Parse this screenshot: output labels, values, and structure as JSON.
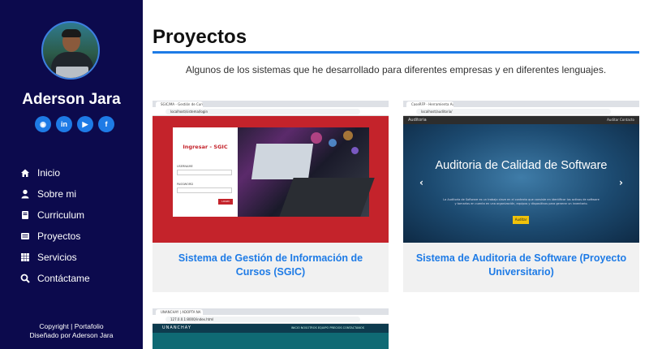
{
  "profile": {
    "name": "Aderson Jara"
  },
  "socials": [
    {
      "icon": "github-icon",
      "glyph": "◉"
    },
    {
      "icon": "linkedin-icon",
      "glyph": "in"
    },
    {
      "icon": "youtube-icon",
      "glyph": "▶"
    },
    {
      "icon": "facebook-icon",
      "glyph": "f"
    }
  ],
  "nav": [
    {
      "label": "Inicio",
      "icon": "home-icon"
    },
    {
      "label": "Sobre mi",
      "icon": "user-icon"
    },
    {
      "label": "Curriculum",
      "icon": "book-icon"
    },
    {
      "label": "Proyectos",
      "icon": "list-icon"
    },
    {
      "label": "Servicios",
      "icon": "grid-icon"
    },
    {
      "label": "Contáctame",
      "icon": "search-icon"
    }
  ],
  "footer": {
    "line1": "Copyright | Portafolio",
    "line2": "Diseñado por Aderson Jara"
  },
  "main": {
    "title": "Proyectos",
    "subtitle": "Algunos de los sistemas que he desarrollado para diferentes empresas y en diferentes lenguajes."
  },
  "projects": [
    {
      "title": "Sistema de Gestión de Información de Cursos (SGIC)",
      "shot": {
        "tab": "SGIC/MA - Gestión de Cursos",
        "url": "localhost/sistema/login",
        "form_title": "Ingresar - SGIC",
        "user_label": "USERNAME",
        "pass_label": "PASSWORD",
        "button": "LOGIN"
      }
    },
    {
      "title": "Sistema de Auditoria de Software (Proyecto Universitario)",
      "shot": {
        "tab": "CaseRFP - Herramienta Auditoria",
        "url": "localhost/auditoria/",
        "brand": "Auditoria",
        "links": "Auditar    Contacto",
        "hero_title": "Auditoria de Calidad de Software",
        "hero_text": "La Auditoría de Software es un trabajo clave en el contexto que consiste en identificar los activos de software y tomarlos en cuenta en una organización, equipos y dispositivos para generar un inventario.",
        "button": "Auditar"
      }
    },
    {
      "title": "",
      "shot": {
        "tab": "UNANCHAY | ADOPTA NA",
        "url": "127.0.0.1:8000/index.html",
        "brand": "UNANCHAY",
        "links": "INICIO   NOSOTROS   EQUIPO   PRECIOS   CONTACTANOS"
      }
    }
  ],
  "colors": {
    "sidebar": "#0c0a4d",
    "accent": "#1e7be6"
  }
}
